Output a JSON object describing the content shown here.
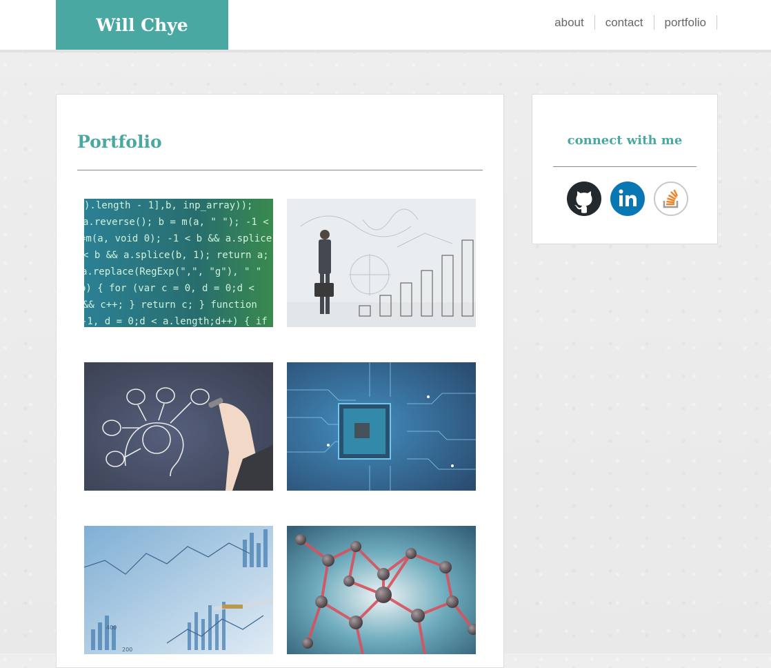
{
  "header": {
    "brand": "Will Chye",
    "nav": [
      {
        "label": "about"
      },
      {
        "label": "contact"
      },
      {
        "label": "portfolio"
      }
    ]
  },
  "main": {
    "title": "Portfolio",
    "items": [
      {
        "name": "code-image",
        "code_lines": [
          ").length - 1],b, inp_array));",
          "a.reverse(); b = m(a, \" \"); -1 <",
          "=m(a, void 0); -1 < b && a.splice",
          "< b && a.splice(b, 1); return a;",
          "a.replace(RegExp(\",\", \"g\"), \" \"",
          "b) { for (var c = 0, d = 0;d <",
          "&& c++; } return c; } function",
          "-1, d = 0;d < a.length;d++) { if"
        ]
      },
      {
        "name": "businessman-chart-image"
      },
      {
        "name": "brain-ideas-image"
      },
      {
        "name": "circuit-chip-image"
      },
      {
        "name": "financial-chart-image",
        "axis_ticks": [
          "400",
          "200"
        ]
      },
      {
        "name": "molecule-image"
      }
    ]
  },
  "sidebar": {
    "heading": "connect with me",
    "social": [
      {
        "name": "github",
        "icon": "github-icon",
        "color": "#24292e"
      },
      {
        "name": "linkedin",
        "icon": "linkedin-icon",
        "color": "#0a77b5"
      },
      {
        "name": "stackoverflow",
        "icon": "stackoverflow-icon",
        "color": "#f48024"
      }
    ]
  },
  "colors": {
    "accent": "#4aa8a2",
    "text": "#666666"
  }
}
